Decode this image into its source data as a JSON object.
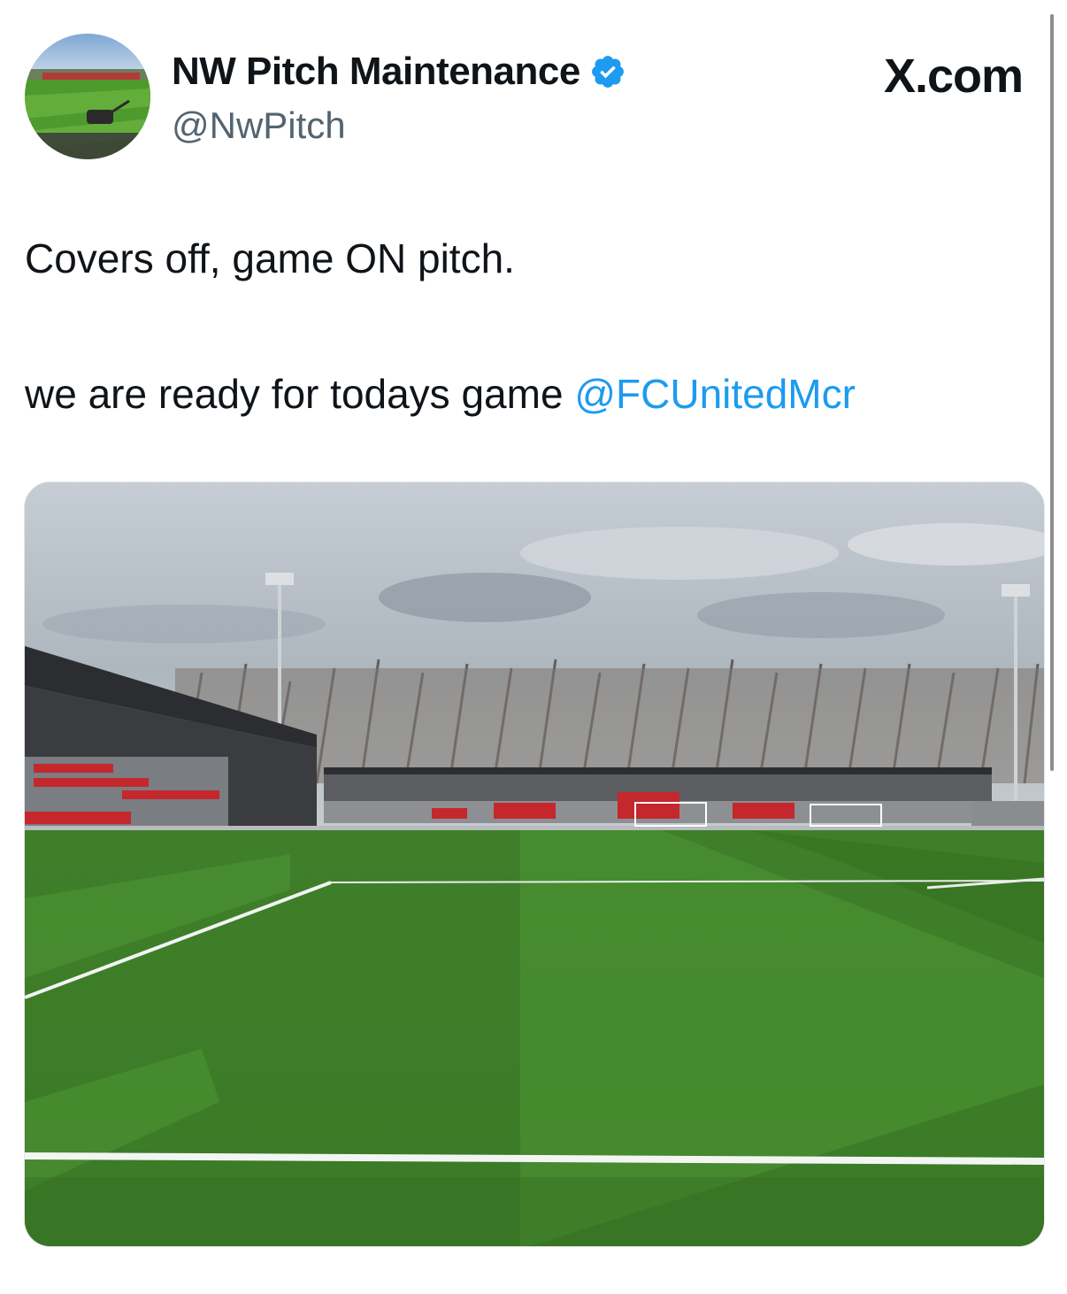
{
  "tweet": {
    "author": {
      "display_name": "NW Pitch Maintenance",
      "handle": "@NwPitch",
      "verified": true,
      "avatar_icon": "pitch-with-roller-avatar"
    },
    "site_label": "X.com",
    "text": {
      "line1": "Covers off, game ON pitch.",
      "line2_prefix": "we are ready for todays game ",
      "mention": "@FCUnitedMcr"
    },
    "media": {
      "kind": "photo",
      "subject": "football-stadium-pitch"
    }
  },
  "colors": {
    "mention": "#1d9bf0",
    "verified_badge": "#1d9bf0",
    "handle": "#536471",
    "text": "#0f1419"
  }
}
